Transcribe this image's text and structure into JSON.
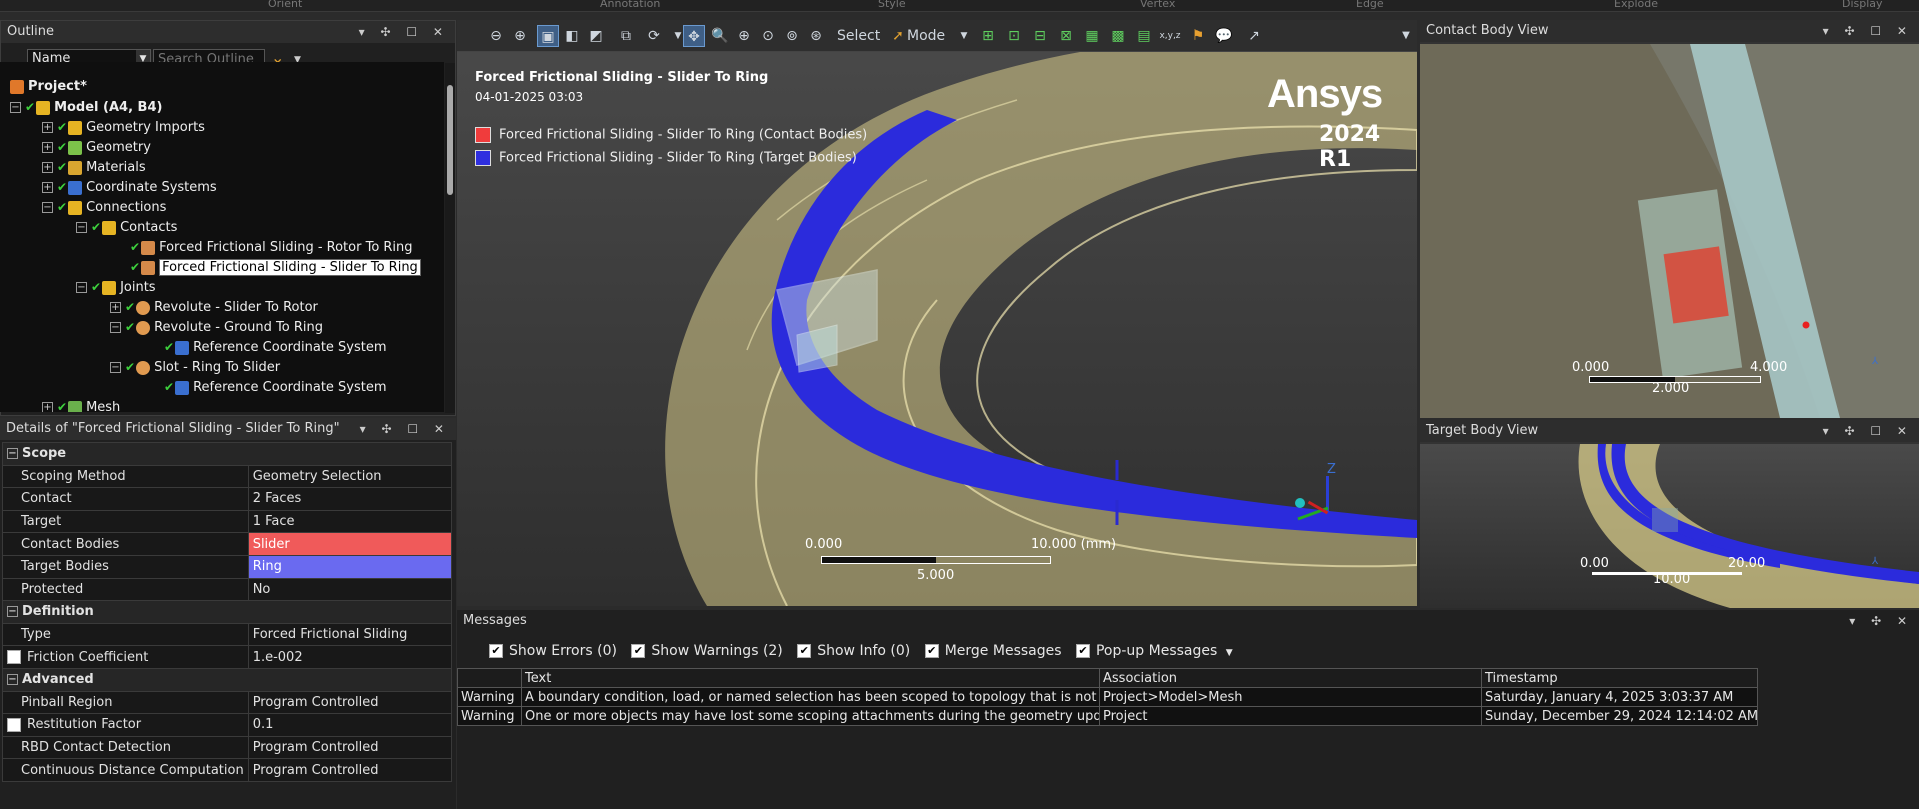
{
  "ribbon": {
    "labels": [
      "Orient",
      "Annotation",
      "Style",
      "Vertex",
      "Edge",
      "Explode",
      "Display"
    ]
  },
  "outline": {
    "title": "Outline",
    "filter_name": "Name",
    "search_placeholder": "Search Outline",
    "tree": [
      {
        "label": "Project*",
        "icon": "project-icon"
      },
      {
        "label": "Model (A4, B4)",
        "icon": "model-icon"
      },
      {
        "label": "Geometry Imports",
        "icon": "geometry-imports-icon"
      },
      {
        "label": "Geometry",
        "icon": "geometry-icon"
      },
      {
        "label": "Materials",
        "icon": "materials-icon"
      },
      {
        "label": "Coordinate Systems",
        "icon": "coordinate-systems-icon"
      },
      {
        "label": "Connections",
        "icon": "connections-icon"
      },
      {
        "label": "Contacts",
        "icon": "contacts-folder-icon"
      },
      {
        "label": "Forced Frictional Sliding - Rotor To Ring",
        "icon": "contact-icon"
      },
      {
        "label": "Forced Frictional Sliding - Slider To Ring",
        "icon": "contact-icon"
      },
      {
        "label": "Joints",
        "icon": "joints-folder-icon"
      },
      {
        "label": "Revolute - Slider To Rotor",
        "icon": "joint-icon"
      },
      {
        "label": "Revolute - Ground To Ring",
        "icon": "joint-icon"
      },
      {
        "label": "Reference Coordinate System",
        "icon": "coordinate-system-icon"
      },
      {
        "label": "Slot - Ring To Slider",
        "icon": "joint-icon"
      },
      {
        "label": "Reference Coordinate System",
        "icon": "coordinate-system-icon"
      },
      {
        "label": "Mesh",
        "icon": "mesh-icon"
      }
    ]
  },
  "details": {
    "title": "Details of \"Forced Frictional Sliding - Slider To Ring\"",
    "rows": [
      {
        "group": "Scope"
      },
      {
        "label": "Scoping Method",
        "value": "Geometry Selection"
      },
      {
        "label": "Contact",
        "value": "2 Faces"
      },
      {
        "label": "Target",
        "value": "1 Face"
      },
      {
        "label": "Contact Bodies",
        "value": "Slider",
        "color": "#f05a5a"
      },
      {
        "label": "Target Bodies",
        "value": "Ring",
        "color": "#6a6af0"
      },
      {
        "label": "Protected",
        "value": "No"
      },
      {
        "group": "Definition"
      },
      {
        "label": "Type",
        "value": "Forced Frictional Sliding"
      },
      {
        "label": "Friction Coefficient",
        "value": "1.e-002",
        "checkbox": true
      },
      {
        "group": "Advanced"
      },
      {
        "label": "Pinball Region",
        "value": "Program Controlled"
      },
      {
        "label": "Restitution Factor",
        "value": "0.1",
        "checkbox": true
      },
      {
        "label": "RBD Contact Detection",
        "value": "Program Controlled"
      },
      {
        "label": "Continuous Distance Computation",
        "value": "Program Controlled"
      }
    ]
  },
  "toolbar": {
    "select": "Select",
    "mode": "Mode"
  },
  "viewport": {
    "title": "Forced Frictional Sliding - Slider To Ring",
    "date": "04-01-2025 03:03",
    "legend": [
      {
        "label": "Forced Frictional Sliding - Slider To Ring (Contact Bodies)",
        "color": "#f03c3c"
      },
      {
        "label": "Forced Frictional Sliding - Slider To Ring (Target Bodies)",
        "color": "#2f2fe0"
      }
    ],
    "brand": "Ansys",
    "version": "2024 R1",
    "scale": {
      "left": "0.000",
      "right": "10.000 (mm)",
      "mid": "5.000"
    },
    "axis": "Z"
  },
  "contact_view": {
    "title": "Contact Body View",
    "scale": {
      "left": "0.000",
      "right": "4.000",
      "mid": "2.000"
    }
  },
  "target_view": {
    "title": "Target Body View",
    "scale": {
      "left": "0.00",
      "right": "20.00",
      "mid": "10.00"
    }
  },
  "messages": {
    "title": "Messages",
    "filters": [
      {
        "label": "Show Errors",
        "count": "(0)"
      },
      {
        "label": "Show Warnings",
        "count": "(2)"
      },
      {
        "label": "Show Info",
        "count": "(0)"
      },
      {
        "label": "Merge Messages",
        "count": ""
      },
      {
        "label": "Pop-up Messages",
        "count": ""
      }
    ],
    "columns": [
      "",
      "Text",
      "Association",
      "Timestamp"
    ],
    "rows": [
      {
        "type": "Warning",
        "text": "A boundary condition, load, or named selection has been scoped to topology that is not",
        "association": "Project>Model>Mesh",
        "timestamp": "Saturday, January 4, 2025 3:03:37 AM"
      },
      {
        "type": "Warning",
        "text": "One or more objects may have lost some scoping attachments during the geometry upda",
        "association": "Project",
        "timestamp": "Sunday, December 29, 2024 12:14:02 AM"
      }
    ]
  }
}
